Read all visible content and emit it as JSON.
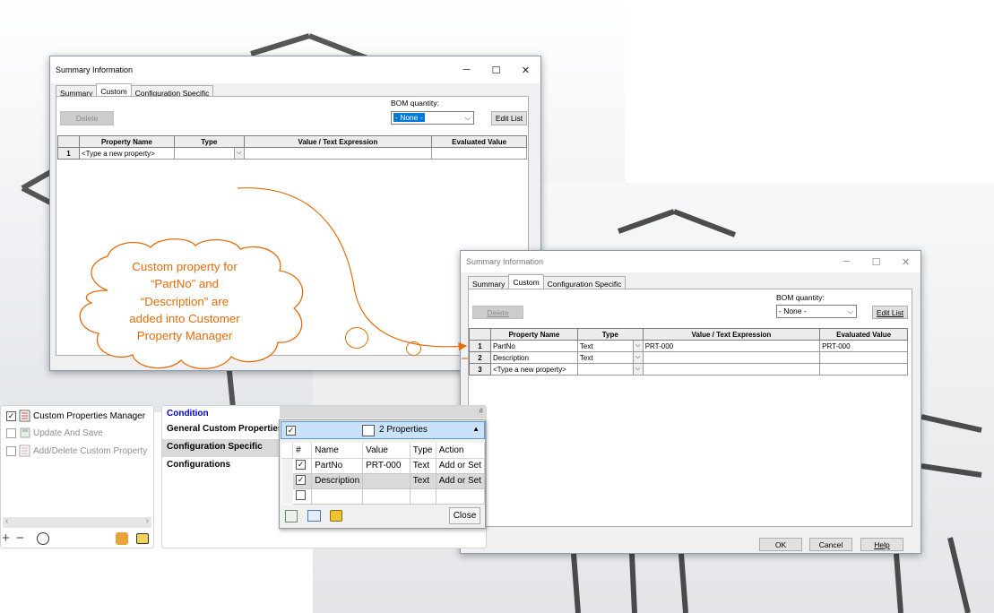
{
  "dialog_top": {
    "title": "Summary Information",
    "tabs": [
      "Summary",
      "Custom",
      "Configuration Specific"
    ],
    "bom_label": "BOM quantity:",
    "bom_value": "- None -",
    "delete_label": "Delete",
    "edit_list_label": "Edit List",
    "columns": [
      "Property Name",
      "Type",
      "Value / Text Expression",
      "Evaluated Value"
    ],
    "rows": [
      {
        "num": "1",
        "name": "<Type a new property>",
        "type": "",
        "value": "",
        "evaluated": ""
      }
    ]
  },
  "dialog_bottom": {
    "title": "Summary Information",
    "tabs": [
      "Summary",
      "Custom",
      "Configuration Specific"
    ],
    "bom_label": "BOM quantity:",
    "bom_value": "- None -",
    "delete_label": "Delete",
    "edit_list_label": "Edit List",
    "columns": [
      "Property Name",
      "Type",
      "Value / Text Expression",
      "Evaluated Value"
    ],
    "rows": [
      {
        "num": "1",
        "name": "PartNo",
        "type": "Text",
        "value": "PRT-000",
        "evaluated": "PRT-000"
      },
      {
        "num": "2",
        "name": "Description",
        "type": "Text",
        "value": "",
        "evaluated": ""
      },
      {
        "num": "3",
        "name": "<Type a new property>",
        "type": "",
        "value": "",
        "evaluated": ""
      }
    ],
    "ok_label": "OK",
    "cancel_label": "Cancel",
    "help_label": "Help"
  },
  "callout": {
    "text_lines": [
      "Custom property for",
      "“PartNo” and",
      "“Description” are",
      "added into Customer",
      "Property Manager"
    ],
    "color": "#e46c0a"
  },
  "left_panel": {
    "items": [
      {
        "label": "Custom Properties Manager",
        "checked": true,
        "icon": "properties-manager-icon"
      },
      {
        "label": "Update And Save",
        "checked": false,
        "icon": "update-save-icon"
      },
      {
        "label": "Add/Delete Custom Property",
        "checked": false,
        "icon": "add-delete-property-icon"
      }
    ]
  },
  "mid_panel": {
    "rows": [
      "Condition",
      "General Custom Properties",
      "Configuration Specific",
      "Configurations"
    ],
    "condition_color": "#0000cc",
    "hash_label": "#"
  },
  "props_popup": {
    "header_label": "2 Properties",
    "columns": [
      "#",
      "Name",
      "Value",
      "Type",
      "Action"
    ],
    "rows": [
      {
        "checked": true,
        "name": "PartNo",
        "value": "PRT-000",
        "type": "Text",
        "action": "Add or Set"
      },
      {
        "checked": true,
        "name": "Description",
        "value": "",
        "type": "Text",
        "action": "Add or Set"
      },
      {
        "checked": false,
        "name": "",
        "value": "",
        "type": "",
        "action": ""
      }
    ],
    "close_label": "Close",
    "header_color": "#c9e2f8"
  }
}
